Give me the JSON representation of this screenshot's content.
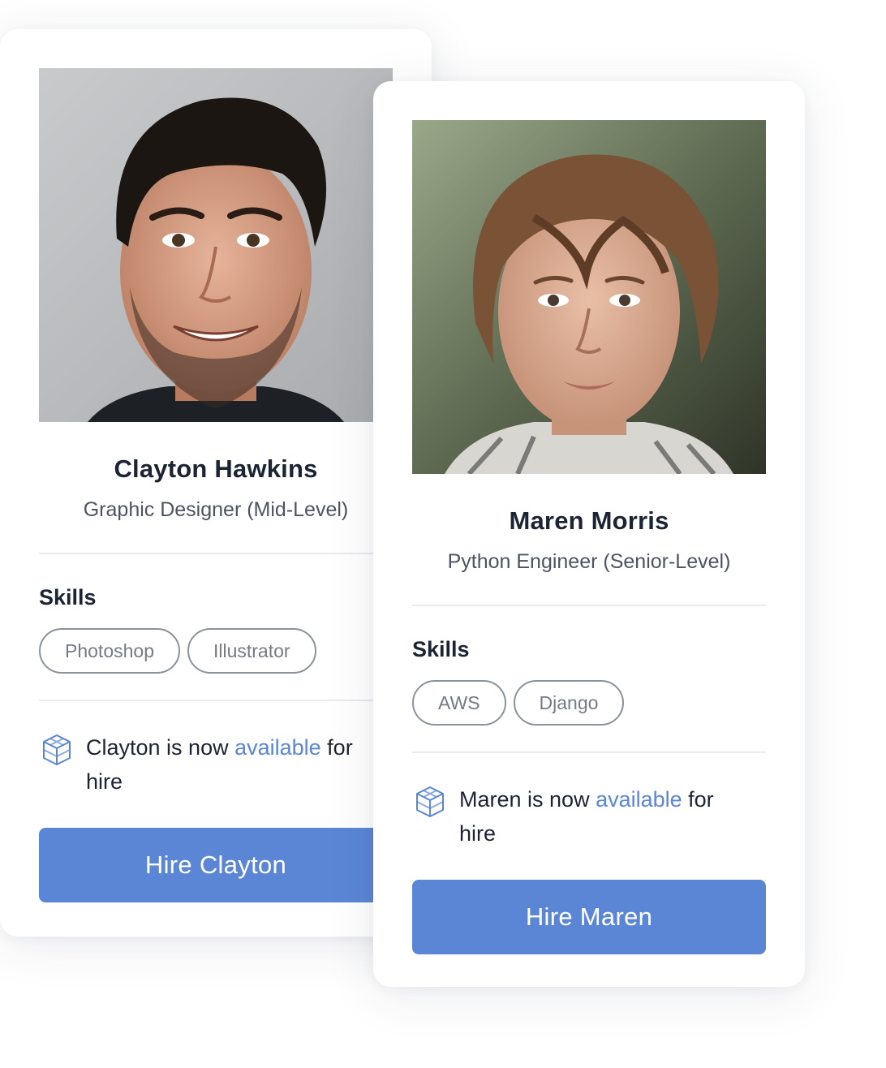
{
  "candidates": [
    {
      "name": "Clayton Hawkins",
      "role": "Graphic Designer (Mid-Level)",
      "skills_title": "Skills",
      "skills": [
        "Photoshop",
        "Illustrator"
      ],
      "availability_prefix": "Clayton is now ",
      "availability_highlight": "available",
      "availability_suffix": " for hire",
      "hire_label": "Hire Clayton",
      "photo_icon": "person-photo"
    },
    {
      "name": "Maren Morris",
      "role": "Python Engineer (Senior-Level)",
      "skills_title": "Skills",
      "skills": [
        "AWS",
        "Django"
      ],
      "availability_prefix": "Maren is now ",
      "availability_highlight": "available",
      "availability_suffix": " for hire",
      "hire_label": "Hire Maren",
      "photo_icon": "person-photo"
    }
  ],
  "colors": {
    "accent": "#5b86d6",
    "text": "#1c2433",
    "muted": "#4d5460",
    "chip_border": "#8a929c"
  },
  "icons": {
    "availability": "cube-icon"
  }
}
